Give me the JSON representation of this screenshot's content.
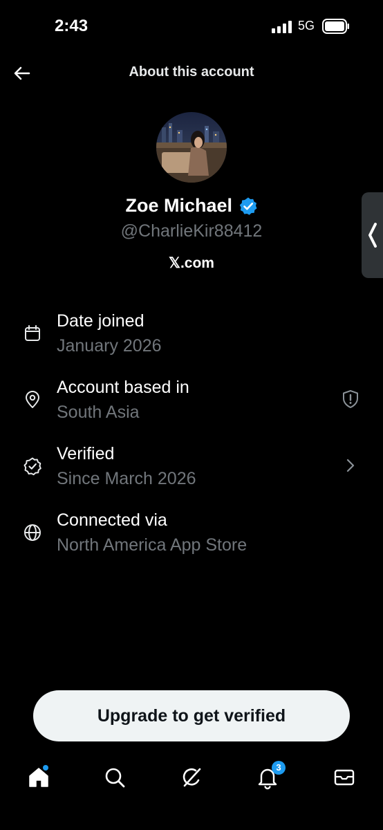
{
  "status_bar": {
    "time": "2:43",
    "network": "5G"
  },
  "header": {
    "title": "About this account",
    "back_icon": "arrow-left-icon"
  },
  "profile": {
    "name": "Zoe Michael",
    "handle": "@CharlieKir88412",
    "site": "𝕏.com",
    "verified_color": "#1d9bf0"
  },
  "info_rows": [
    {
      "label": "Date joined",
      "value": "January 2026",
      "icon": "calendar-icon"
    },
    {
      "label": "Account based in",
      "value": "South Asia",
      "icon": "location-pin-icon",
      "trailing_icon": "shield-alert-icon"
    },
    {
      "label": "Verified",
      "value": "Since March 2026",
      "icon": "verified-check-icon",
      "trailing_icon": "chevron-right-icon"
    },
    {
      "label": "Connected via",
      "value": "North America App Store",
      "icon": "globe-icon"
    }
  ],
  "upgrade_button": {
    "label": "Upgrade to get verified"
  },
  "bottom_nav": {
    "items": [
      "home-icon",
      "search-icon",
      "grok-icon",
      "notifications-icon",
      "messages-icon"
    ],
    "notification_count": "3"
  }
}
